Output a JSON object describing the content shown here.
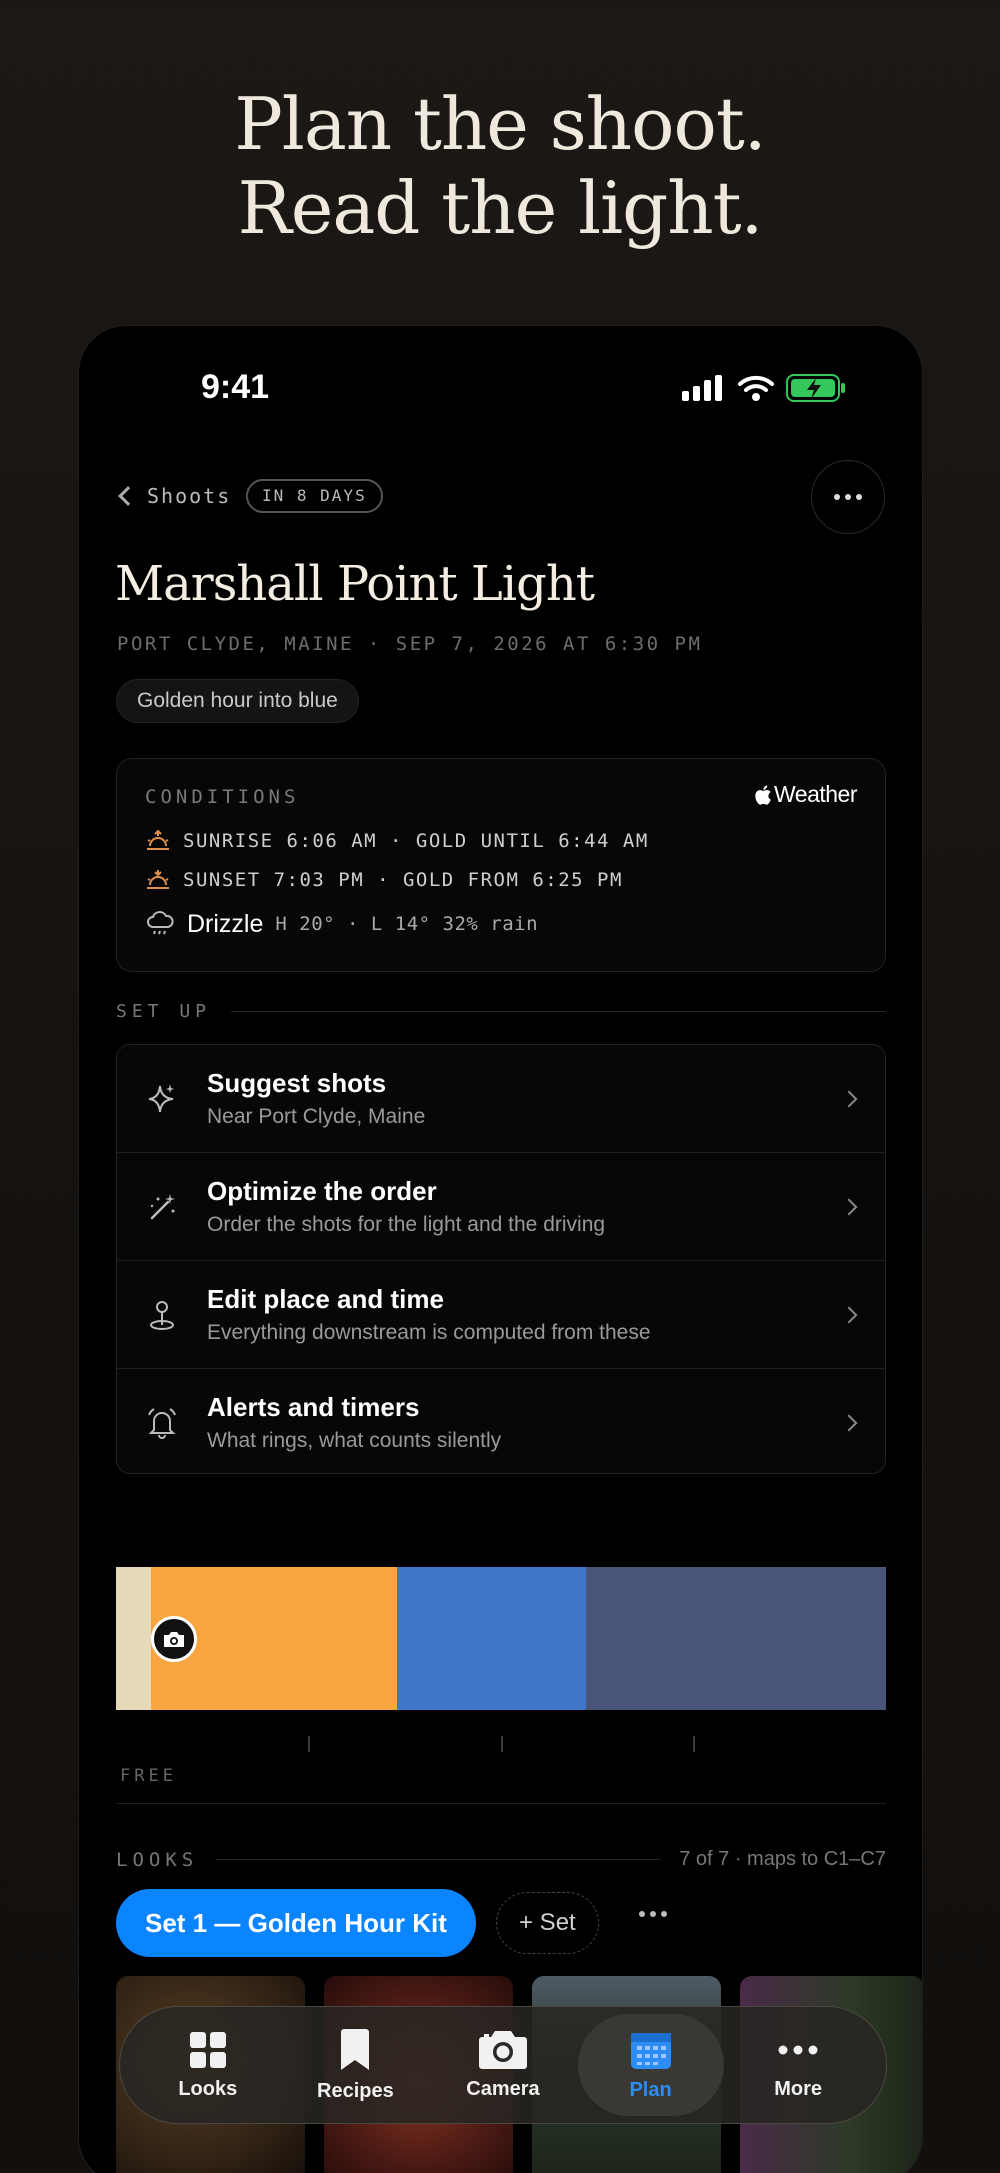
{
  "hero": {
    "line1": "Plan the shoot.",
    "line2": "Read the light."
  },
  "status_bar": {
    "time": "9:41"
  },
  "nav": {
    "back_label": "Shoots",
    "badge": "IN 8 DAYS"
  },
  "shoot": {
    "title": "Marshall Point Light",
    "subtitle": "PORT CLYDE, MAINE · SEP 7, 2026 AT 6:30 PM",
    "mood": "Golden hour into blue"
  },
  "conditions": {
    "label": "CONDITIONS",
    "provider": "Weather",
    "sunrise": "SUNRISE 6:06 AM · GOLD UNTIL 6:44 AM",
    "sunset": "SUNSET 7:03 PM · GOLD FROM 6:25 PM",
    "weather": "Drizzle",
    "detail": "H 20° · L 14° 32% rain",
    "accent": "#e0904a"
  },
  "setup": {
    "label": "SET UP",
    "items": [
      {
        "title": "Suggest shots",
        "sub": "Near Port Clyde, Maine",
        "icon": "sparkle-icon"
      },
      {
        "title": "Optimize the order",
        "sub": "Order the shots for the light and the driving",
        "icon": "magic-wand-icon"
      },
      {
        "title": "Edit place and time",
        "sub": "Everything downstream is computed from these",
        "icon": "location-pin-icon"
      },
      {
        "title": "Alerts and timers",
        "sub": "What rings, what counts silently",
        "icon": "bell-icon"
      }
    ]
  },
  "timeline": {
    "segments": [
      {
        "name": "daylight",
        "color": "#e6d9b8",
        "fraction": 0.046
      },
      {
        "name": "golden",
        "color": "#f6a541",
        "fraction": 0.319
      },
      {
        "name": "blue",
        "color": "#3f76c8",
        "fraction": 0.245
      },
      {
        "name": "night",
        "color": "#485578",
        "fraction": 0.39
      }
    ],
    "marker_icon": "camera-icon",
    "free_label": "FREE"
  },
  "looks": {
    "label": "LOOKS",
    "count": "7 of 7 · maps to C1–C7",
    "active_set": "Set 1 — Golden Hour Kit",
    "add_set": "+ Set"
  },
  "tabs": [
    {
      "label": "Looks",
      "icon": "grid-icon"
    },
    {
      "label": "Recipes",
      "icon": "bookmark-icon"
    },
    {
      "label": "Camera",
      "icon": "camera-icon"
    },
    {
      "label": "Plan",
      "icon": "calendar-icon",
      "active": true
    },
    {
      "label": "More",
      "icon": "ellipsis-icon"
    }
  ]
}
